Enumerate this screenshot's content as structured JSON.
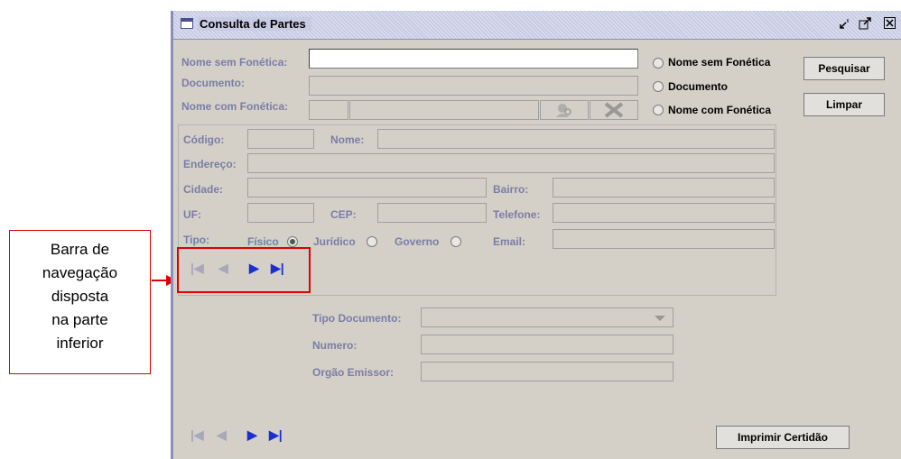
{
  "window": {
    "title": "Consulta de Partes",
    "controls": [
      "minimize-icon",
      "maximize-icon",
      "close-icon"
    ]
  },
  "search": {
    "nome_sem_fonetica_label": "Nome sem Fonética:",
    "nome_sem_fonetica_value": "",
    "documento_label": "Documento:",
    "documento_value": "",
    "nome_com_fonetica_label": "Nome com Fonética:",
    "radio_options": [
      {
        "label": "Nome sem Fonética",
        "selected": false
      },
      {
        "label": "Documento",
        "selected": false
      },
      {
        "label": "Nome com Fonética",
        "selected": false
      }
    ],
    "pesquisar_label": "Pesquisar",
    "limpar_label": "Limpar"
  },
  "details": {
    "codigo_label": "Código:",
    "nome_label": "Nome:",
    "endereco_label": "Endereço:",
    "cidade_label": "Cidade:",
    "bairro_label": "Bairro:",
    "uf_label": "UF:",
    "cep_label": "CEP:",
    "telefone_label": "Telefone:",
    "tipo_label": "Tipo:",
    "tipo_options": [
      {
        "label": "Físico",
        "selected": true
      },
      {
        "label": "Jurídico",
        "selected": false
      },
      {
        "label": "Governo",
        "selected": false
      }
    ],
    "email_label": "Email:"
  },
  "documents": {
    "tipo_documento_label": "Tipo Documento:",
    "numero_label": "Numero:",
    "orgao_emissor_label": "Orgão Emissor:"
  },
  "navigation": {
    "first": "|◀",
    "prev": "◀",
    "next": "▶",
    "last": "▶|"
  },
  "footer": {
    "imprimir_label": "Imprimir Certidão"
  },
  "callout": {
    "text_lines": [
      "Barra de",
      "navegação",
      "disposta",
      "na parte",
      "inferior"
    ]
  },
  "colors": {
    "label": "#7a7da6",
    "titlebar": "#c7cbe4",
    "nav_active": "#1a2fd0",
    "callout_border": "#e00000"
  }
}
